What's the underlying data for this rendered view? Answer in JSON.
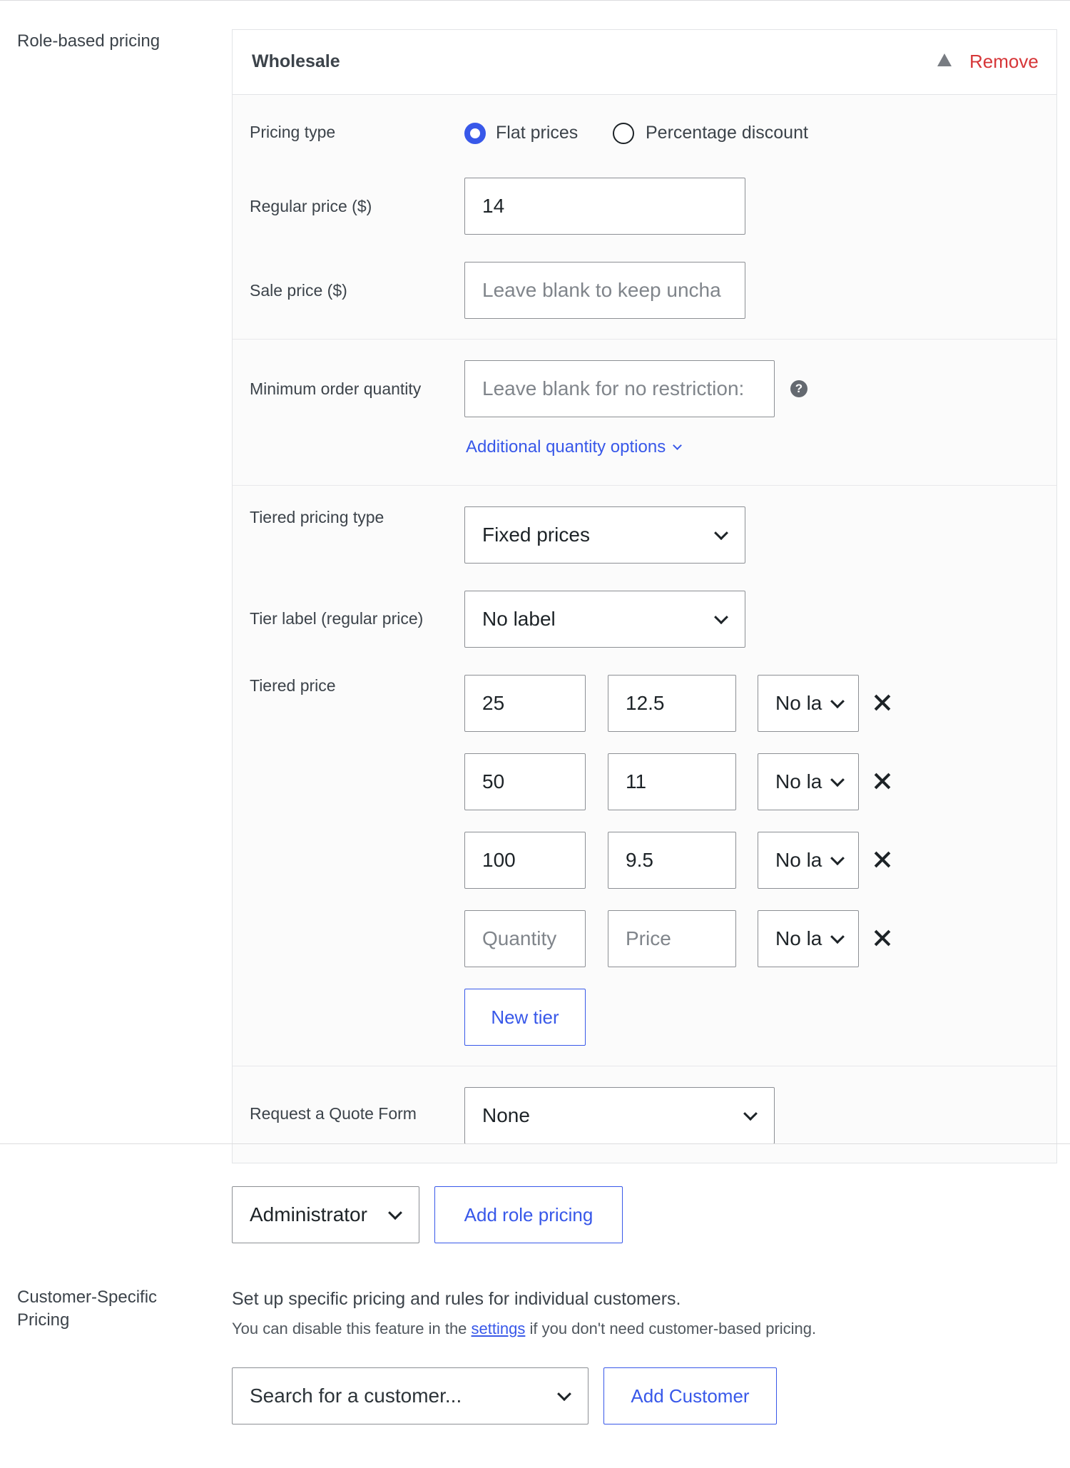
{
  "role_pricing": {
    "section_label": "Role-based pricing",
    "role": {
      "title": "Wholesale",
      "remove_label": "Remove",
      "pricing_type": {
        "label": "Pricing type",
        "options": [
          "Flat prices",
          "Percentage discount"
        ],
        "selected": "Flat prices"
      },
      "regular_price": {
        "label": "Regular price ($)",
        "value": "14"
      },
      "sale_price": {
        "label": "Sale price ($)",
        "value": "",
        "placeholder": "Leave blank to keep uncha"
      },
      "min_qty": {
        "label": "Minimum order quantity",
        "value": "",
        "placeholder": "Leave blank for no restriction:",
        "help_glyph": "?"
      },
      "additional_qty_link": "Additional quantity options",
      "tiered_type": {
        "label": "Tiered pricing type",
        "value": "Fixed prices"
      },
      "tier_label": {
        "label": "Tier label (regular price)",
        "value": "No label"
      },
      "tiered_price": {
        "label": "Tiered price",
        "rows": [
          {
            "quantity": "25",
            "price": "12.5",
            "label": "No la"
          },
          {
            "quantity": "50",
            "price": "11",
            "label": "No la"
          },
          {
            "quantity": "100",
            "price": "9.5",
            "label": "No la"
          },
          {
            "quantity": "",
            "price": "",
            "label": "No la",
            "quantity_placeholder": "Quantity",
            "price_placeholder": "Price"
          }
        ],
        "new_tier_label": "New tier"
      },
      "quote_form": {
        "label": "Request a Quote Form",
        "value": "None"
      }
    },
    "role_select": {
      "value": "Administrator"
    },
    "add_role_label": "Add role pricing"
  },
  "customer_pricing": {
    "section_label_line1": "Customer-Specific",
    "section_label_line2": "Pricing",
    "description": "Set up specific pricing and rules for individual customers.",
    "note_before": "You can disable this feature in the ",
    "note_link": "settings",
    "note_after": " if you don't need customer-based pricing.",
    "search_placeholder": "Search for a customer...",
    "add_customer_label": "Add Customer"
  },
  "colors": {
    "accent": "#3858e9",
    "remove": "#d63638",
    "border": "#8c8f94"
  }
}
